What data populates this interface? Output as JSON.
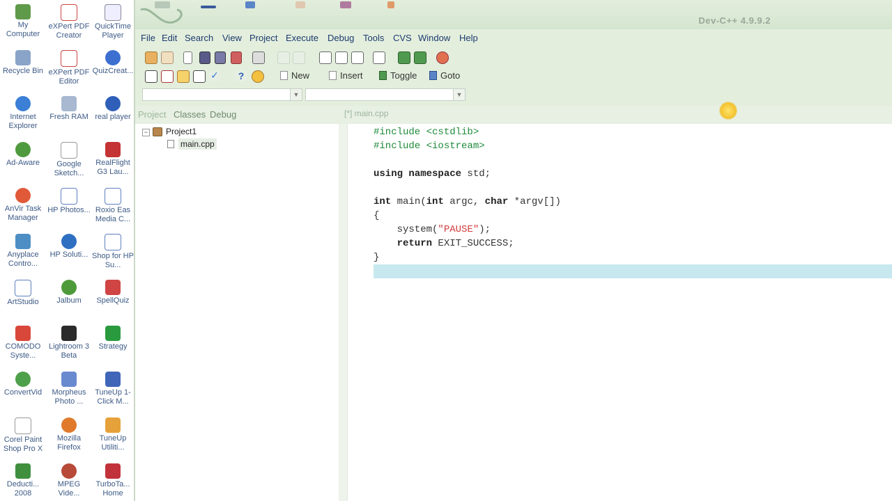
{
  "desktop": {
    "icons": [
      {
        "label": "My Computer"
      },
      {
        "label": "eXPert PDF Creator"
      },
      {
        "label": "QuickTime Player"
      },
      {
        "label": "Recycle Bin"
      },
      {
        "label": "eXPert PDF Editor"
      },
      {
        "label": "QuizCreat..."
      },
      {
        "label": "Internet Explorer"
      },
      {
        "label": "Fresh RAM"
      },
      {
        "label": "real player"
      },
      {
        "label": "Ad-Aware"
      },
      {
        "label": "Google Sketch..."
      },
      {
        "label": "RealFlight G3 Lau..."
      },
      {
        "label": "AnVir Task Manager"
      },
      {
        "label": "HP Photos..."
      },
      {
        "label": "Roxio Eas Media C..."
      },
      {
        "label": "Anyplace Contro..."
      },
      {
        "label": "HP Soluti..."
      },
      {
        "label": "Shop for HP Su..."
      },
      {
        "label": "ArtStudio"
      },
      {
        "label": "Jalbum"
      },
      {
        "label": "SpellQuiz"
      },
      {
        "label": "COMODO Syste..."
      },
      {
        "label": "Lightroom 3 Beta"
      },
      {
        "label": "Strategy"
      },
      {
        "label": "ConvertVid"
      },
      {
        "label": "Morpheus Photo ..."
      },
      {
        "label": "TuneUp 1-Click M..."
      },
      {
        "label": "Corel Paint Shop Pro X"
      },
      {
        "label": "Mozilla Firefox"
      },
      {
        "label": "TuneUp Utiliti..."
      },
      {
        "label": "Deducti... 2008"
      },
      {
        "label": "MPEG Vide..."
      },
      {
        "label": "TurboTa... Home"
      }
    ]
  },
  "window": {
    "title": "Dev-C++ 4.9.9.2"
  },
  "menu": {
    "items": [
      "File",
      "Edit",
      "Search",
      "View",
      "Project",
      "Execute",
      "Debug",
      "Tools",
      "CVS",
      "Window",
      "Help"
    ]
  },
  "toolbar2": {
    "new_label": "New",
    "insert_label": "Insert",
    "toggle_label": "Toggle",
    "goto_label": "Goto"
  },
  "panels": {
    "tabs": [
      "Project",
      "Classes",
      "Debug"
    ],
    "editor_tab": "[*] main.cpp"
  },
  "project_tree": {
    "project": "Project1",
    "file": "main.cpp"
  },
  "editor": {
    "lines": {
      "l1": "#include <cstdlib>",
      "l2": "#include <iostream>",
      "l4a": "using namespace",
      "l4b": " std;",
      "l6a": "int",
      "l6b": " main(",
      "l6c": "int",
      "l6d": " argc, ",
      "l6e": "char",
      "l6f": " *argv[])",
      "l7": "{",
      "l8a": "    system(",
      "l8b": "\"PAUSE\"",
      "l8c": ");",
      "l9a": "    return",
      "l9b": " EXIT_SUCCESS;",
      "l10": "}"
    }
  },
  "colors": {
    "chrome_bg": "#e3eedd",
    "preprocessor": "#1f8a3a",
    "string": "#d13b3b",
    "current_line": "#c7e8ee"
  }
}
